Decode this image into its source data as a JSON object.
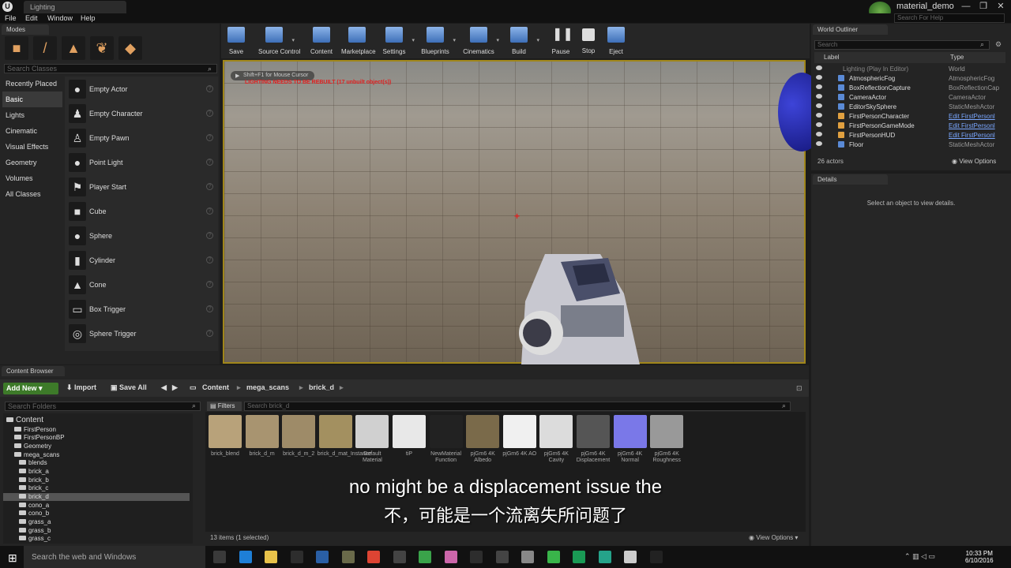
{
  "window": {
    "level_tab": "Lighting",
    "project": "material_demo",
    "help_search_placeholder": "Search For Help",
    "buttons": {
      "minimize": "—",
      "maximize": "❐",
      "close": "✕"
    }
  },
  "menu": [
    "File",
    "Edit",
    "Window",
    "Help"
  ],
  "modes": {
    "tab": "Modes",
    "search_placeholder": "Search Classes",
    "categories": [
      "Recently Placed",
      "Basic",
      "Lights",
      "Cinematic",
      "Visual Effects",
      "Geometry",
      "Volumes",
      "All Classes"
    ],
    "selected_category": "Basic",
    "items": [
      "Empty Actor",
      "Empty Character",
      "Empty Pawn",
      "Point Light",
      "Player Start",
      "Cube",
      "Sphere",
      "Cylinder",
      "Cone",
      "Box Trigger",
      "Sphere Trigger"
    ]
  },
  "toolbar": [
    "Save",
    "Source Control",
    "Content",
    "Marketplace",
    "Settings",
    "Blueprints",
    "Cinematics",
    "Build",
    "Pause",
    "Stop",
    "Eject"
  ],
  "viewport": {
    "hint": "Shift+F1 for Mouse Cursor",
    "warning": "LIGHTING NEEDS TO BE REBUILT (17 unbuilt object(s))"
  },
  "outliner": {
    "tab": "World Outliner",
    "search_placeholder": "Search",
    "col_label": "Label",
    "col_type": "Type",
    "rows": [
      {
        "label": "Lighting (Play In Editor)",
        "type": "World"
      },
      {
        "label": "AtmosphericFog",
        "type": "AtmosphericFog"
      },
      {
        "label": "BoxReflectionCapture",
        "type": "BoxReflectionCap"
      },
      {
        "label": "CameraActor",
        "type": "CameraActor"
      },
      {
        "label": "EditorSkySphere",
        "type": "StaticMeshActor"
      },
      {
        "label": "FirstPersonCharacter",
        "type": "Edit FirstPersonl"
      },
      {
        "label": "FirstPersonGameMode",
        "type": "Edit FirstPersonl"
      },
      {
        "label": "FirstPersonHUD",
        "type": "Edit FirstPersonl"
      },
      {
        "label": "Floor",
        "type": "StaticMeshActor"
      }
    ],
    "count": "26 actors",
    "view_options": "View Options"
  },
  "details": {
    "tab": "Details",
    "message": "Select an object to view details."
  },
  "content_browser": {
    "tab": "Content Browser",
    "add_new": "Add New",
    "import": "Import",
    "save_all": "Save All",
    "breadcrumb": [
      "Content",
      "mega_scans",
      "brick_d"
    ],
    "folder_search_placeholder": "Search Folders",
    "filters": "Filters",
    "asset_search_placeholder": "Search brick_d",
    "folders": [
      "Content",
      "FirstPerson",
      "FirstPersonBP",
      "Geometry",
      "mega_scans",
      "blends",
      "brick_a",
      "brick_b",
      "brick_c",
      "brick_d",
      "cono_a",
      "cono_b",
      "grass_a",
      "grass_b",
      "grass_c"
    ],
    "selected_folder": "brick_d",
    "assets": [
      {
        "name": "brick_blend",
        "color": "#b8a27a"
      },
      {
        "name": "brick_d_m",
        "color": "#a89470"
      },
      {
        "name": "brick_d_m_2",
        "color": "#9e8b68"
      },
      {
        "name": "brick_d_mat_Instance",
        "color": "#a39060"
      },
      {
        "name": "Default Material",
        "color": "#d0d0d0"
      },
      {
        "name": "tiP",
        "color": "#e8e8e8"
      },
      {
        "name": "NewMaterial Function",
        "color": "#222222"
      },
      {
        "name": "pjGm6 4K Albedo",
        "color": "#7a6a4a"
      },
      {
        "name": "pjGm6 4K AO",
        "color": "#f0f0f0"
      },
      {
        "name": "pjGm6 4K Cavity",
        "color": "#dcdcdc"
      },
      {
        "name": "pjGm6 4K Displacement",
        "color": "#555555"
      },
      {
        "name": "pjGm6 4K Normal",
        "color": "#7a78e8"
      },
      {
        "name": "pjGm6 4K Roughness",
        "color": "#999999"
      }
    ],
    "items_count": "13 items (1 selected)",
    "view_options": "View Options"
  },
  "subtitles": {
    "en": "no might be a displacement issue the",
    "zh": "不，可能是一个流离失所问题了"
  },
  "taskbar": {
    "search": "Search the web and Windows",
    "time": "10:33 PM",
    "date": "6/10/2016",
    "apps": [
      "#3a3a3a",
      "#1e7fd6",
      "#e8c24a",
      "#2d2d2d",
      "#2a5fa5",
      "#6a6a4a",
      "#dd4433",
      "#444444",
      "#3aa34a",
      "#cc66aa",
      "#2d2d2d",
      "#444444",
      "#888888",
      "#39b54a",
      "#1a9a55",
      "#25a38a",
      "#cccccc",
      "#222222"
    ]
  }
}
